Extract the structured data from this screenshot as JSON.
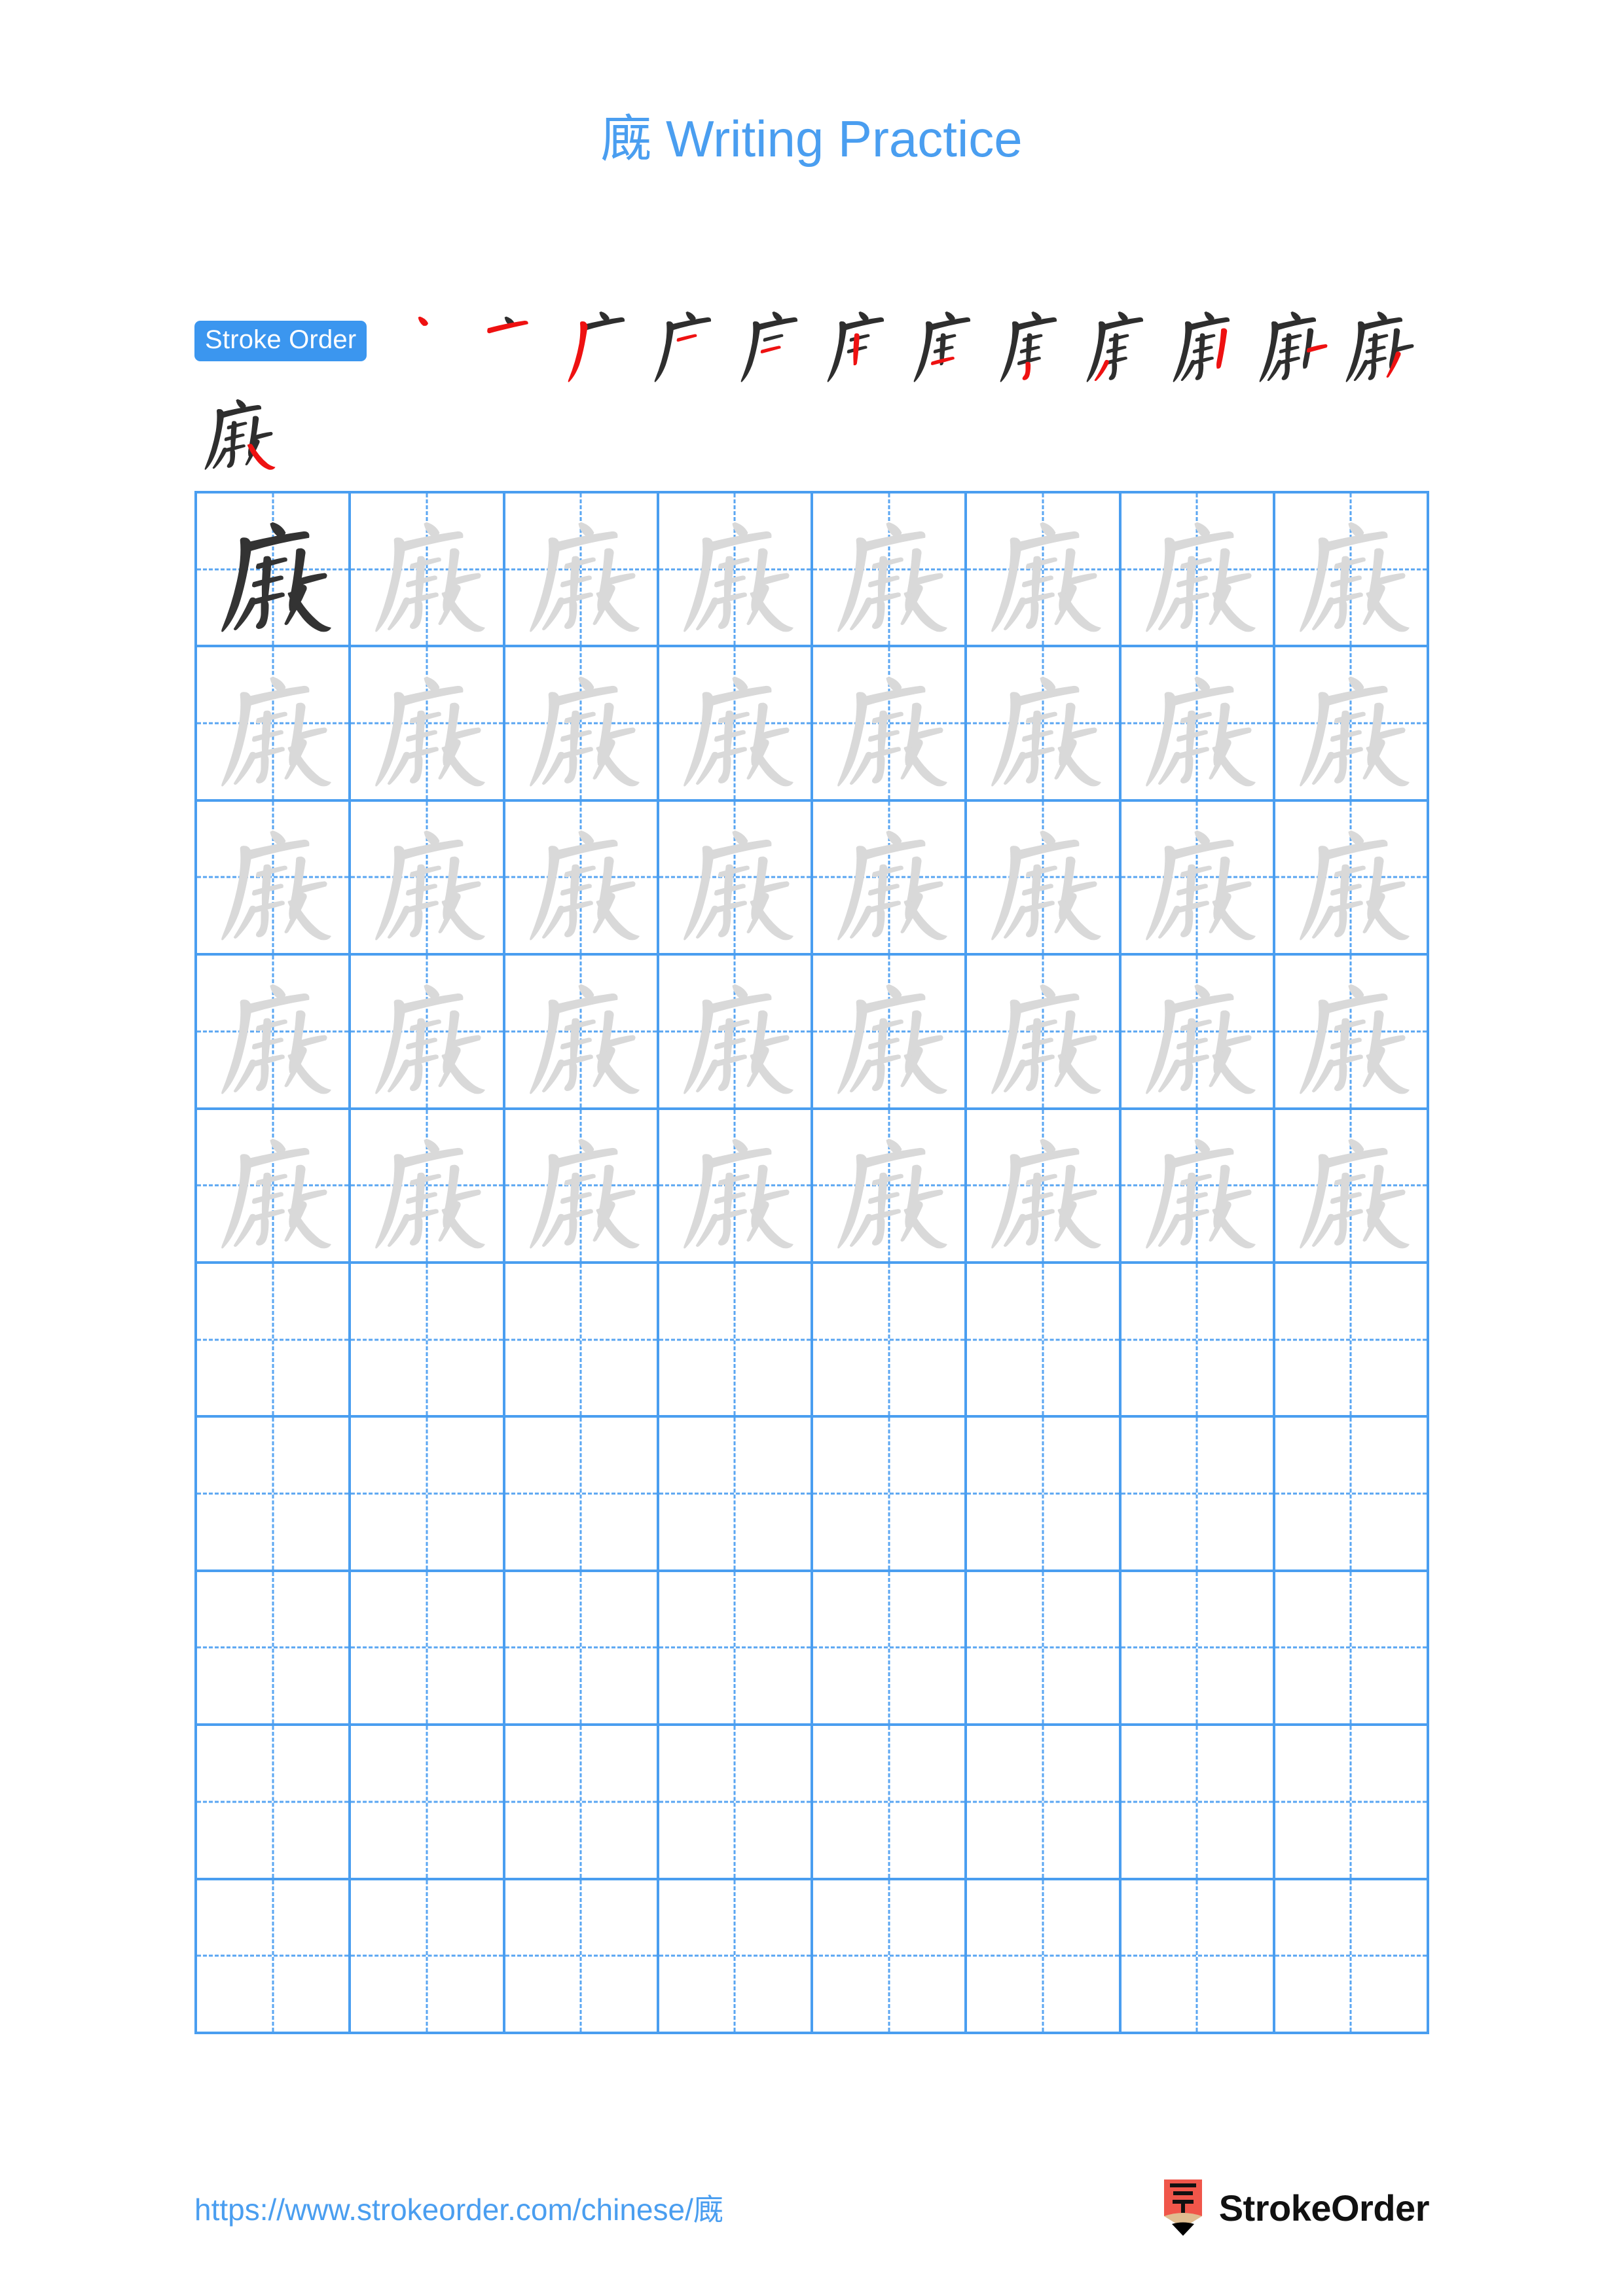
{
  "character": "廐",
  "title": {
    "character": "廐",
    "text": " Writing Practice",
    "full": "廐 Writing Practice",
    "color": "#4a9ef0"
  },
  "stroke_order": {
    "badge_label": "Stroke Order",
    "badge_bg": "#3b96ef",
    "badge_text_color": "#ffffff",
    "total_strokes": 13,
    "existing_stroke_color": "#2e2e2e",
    "new_stroke_color": "#ee1111",
    "steps": [
      {
        "index": 1,
        "new_stroke": "dot",
        "strokes_shown": 1
      },
      {
        "index": 2,
        "new_stroke": "horizontal",
        "strokes_shown": 2
      },
      {
        "index": 3,
        "new_stroke": "left-falling-vertical",
        "strokes_shown": 3
      },
      {
        "index": 4,
        "new_stroke": "short-horizontal",
        "strokes_shown": 4
      },
      {
        "index": 5,
        "new_stroke": "short-horizontal-2",
        "strokes_shown": 5
      },
      {
        "index": 6,
        "new_stroke": "vertical",
        "strokes_shown": 6
      },
      {
        "index": 7,
        "new_stroke": "horizontal-3",
        "strokes_shown": 7
      },
      {
        "index": 8,
        "new_stroke": "hook",
        "strokes_shown": 8
      },
      {
        "index": 9,
        "new_stroke": "left-falling",
        "strokes_shown": 9
      },
      {
        "index": 10,
        "new_stroke": "right-vertical",
        "strokes_shown": 10
      },
      {
        "index": 11,
        "new_stroke": "short-stroke",
        "strokes_shown": 11
      },
      {
        "index": 12,
        "new_stroke": "left-falling-2",
        "strokes_shown": 12
      },
      {
        "index": 13,
        "new_stroke": "final-right-falling",
        "strokes_shown": 13
      }
    ]
  },
  "grid": {
    "columns": 8,
    "rows": 10,
    "line_color": "#4a9ef0",
    "guide_color": "#5aa6f2",
    "dark_glyph_color": "#333333",
    "light_glyph_color": "#d9d9d9",
    "filled_rows": 5,
    "empty_rows": 5,
    "cells": [
      [
        "dark",
        "light",
        "light",
        "light",
        "light",
        "light",
        "light",
        "light"
      ],
      [
        "light",
        "light",
        "light",
        "light",
        "light",
        "light",
        "light",
        "light"
      ],
      [
        "light",
        "light",
        "light",
        "light",
        "light",
        "light",
        "light",
        "light"
      ],
      [
        "light",
        "light",
        "light",
        "light",
        "light",
        "light",
        "light",
        "light"
      ],
      [
        "light",
        "light",
        "light",
        "light",
        "light",
        "light",
        "light",
        "light"
      ],
      [
        "empty",
        "empty",
        "empty",
        "empty",
        "empty",
        "empty",
        "empty",
        "empty"
      ],
      [
        "empty",
        "empty",
        "empty",
        "empty",
        "empty",
        "empty",
        "empty",
        "empty"
      ],
      [
        "empty",
        "empty",
        "empty",
        "empty",
        "empty",
        "empty",
        "empty",
        "empty"
      ],
      [
        "empty",
        "empty",
        "empty",
        "empty",
        "empty",
        "empty",
        "empty",
        "empty"
      ],
      [
        "empty",
        "empty",
        "empty",
        "empty",
        "empty",
        "empty",
        "empty",
        "empty"
      ]
    ]
  },
  "footer": {
    "url": "https://www.strokeorder.com/chinese/廐",
    "url_color": "#4a9ef0",
    "brand_name": "StrokeOrder",
    "logo": {
      "icon_name": "pencil-zi-logo",
      "body_color": "#f0564a",
      "wood_color": "#e0bd90",
      "tip_color": "#000000",
      "glyph": "字"
    }
  }
}
